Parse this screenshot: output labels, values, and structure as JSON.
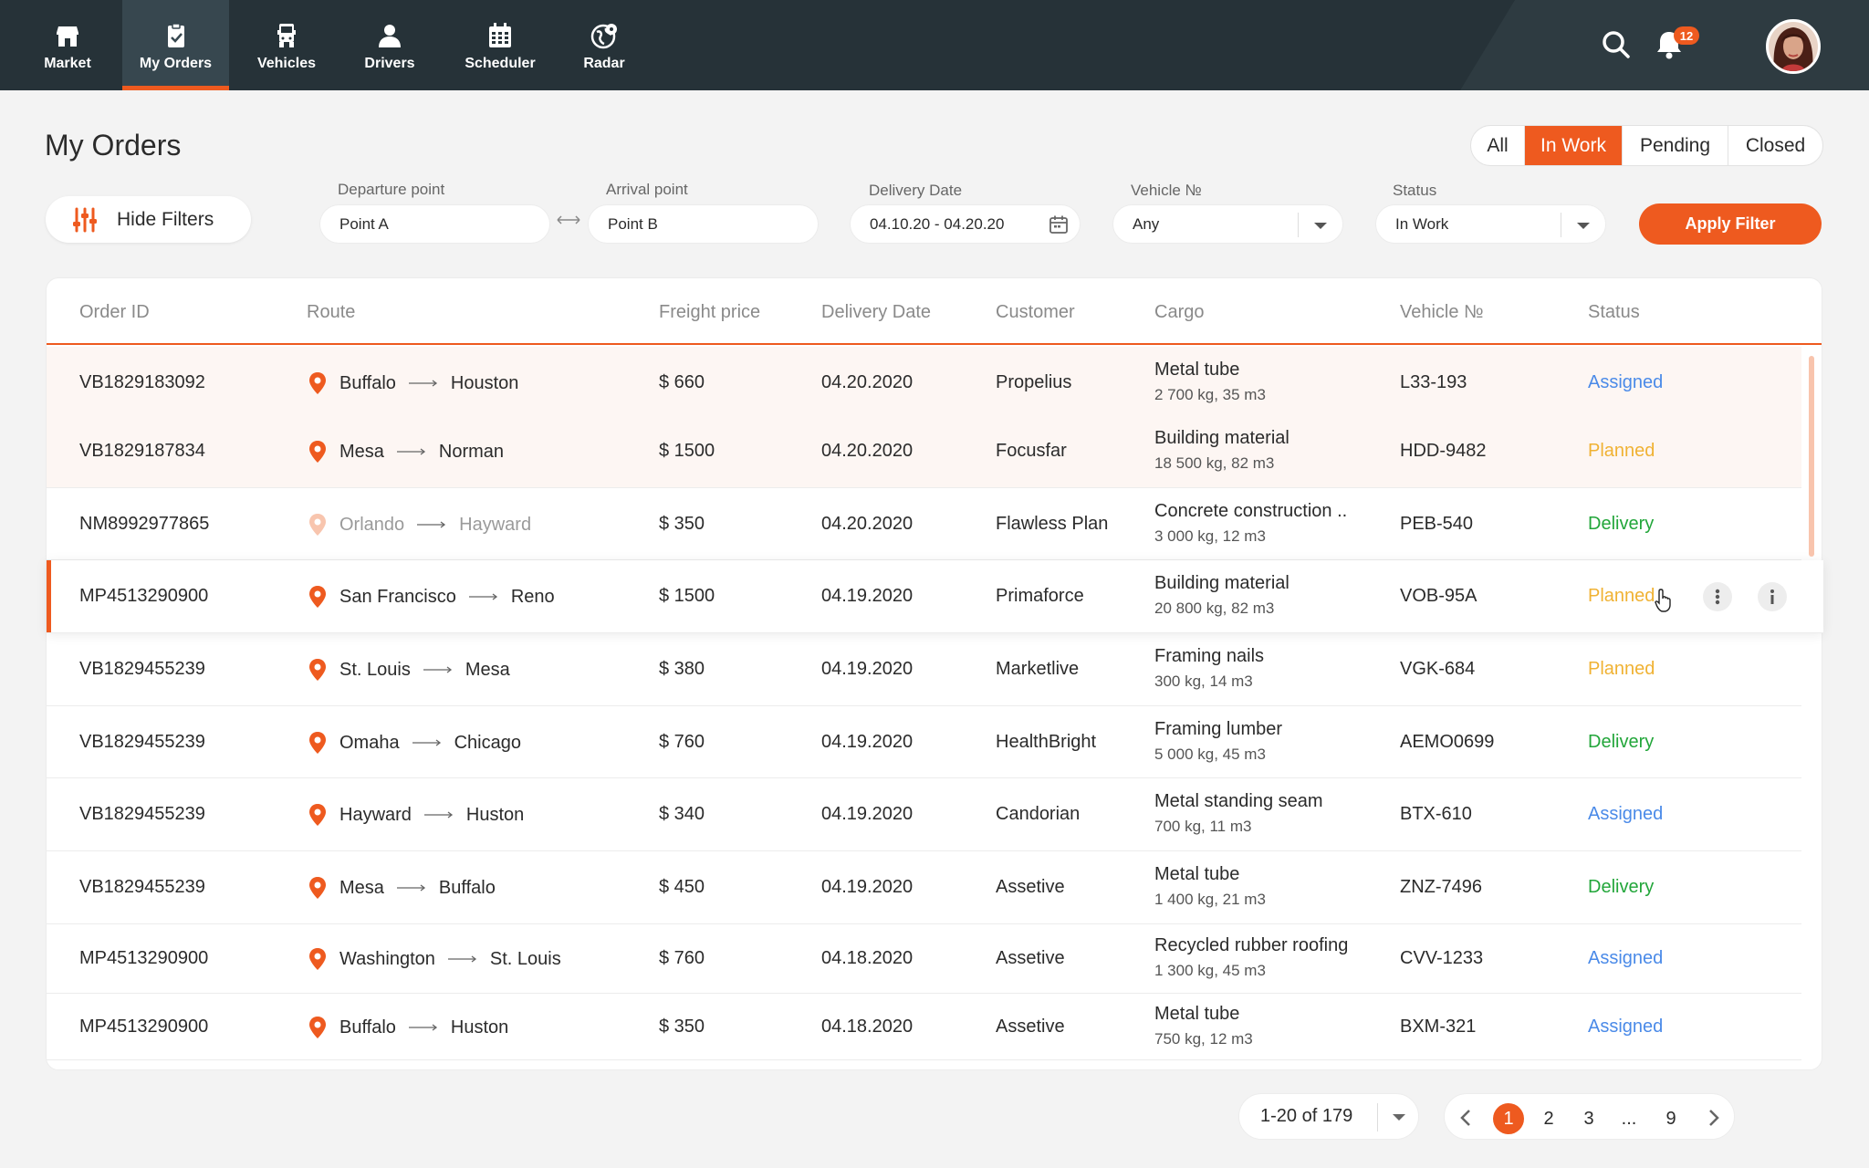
{
  "colors": {
    "accent": "#ee5a1f",
    "nav_bg": "#263238",
    "assigned": "#4a8ae8",
    "planned": "#f0b233",
    "delivery": "#22a63a"
  },
  "nav": {
    "items": [
      {
        "label": "Market",
        "icon": "market-icon"
      },
      {
        "label": "My Orders",
        "icon": "clipboard-icon",
        "active": true
      },
      {
        "label": "Vehicles",
        "icon": "truck-icon"
      },
      {
        "label": "Drivers",
        "icon": "driver-icon"
      },
      {
        "label": "Scheduler",
        "icon": "calendar-icon"
      },
      {
        "label": "Radar",
        "icon": "radar-icon"
      }
    ],
    "notification_count": "12"
  },
  "page": {
    "title": "My Orders"
  },
  "status_tabs": [
    "All",
    "In Work",
    "Pending",
    "Closed"
  ],
  "active_tab": "In Work",
  "filters": {
    "hide_label": "Hide Filters",
    "departure": {
      "label": "Departure point",
      "value": "Point A"
    },
    "arrival": {
      "label": "Arrival point",
      "value": "Point B"
    },
    "delivery_date": {
      "label": "Delivery Date",
      "value": "04.10.20 - 04.20.20"
    },
    "vehicle": {
      "label": "Vehicle №",
      "value": "Any"
    },
    "status": {
      "label": "Status",
      "value": "In Work"
    },
    "apply_label": "Apply Filter"
  },
  "table": {
    "headers": [
      "Order ID",
      "Route",
      "Freight price",
      "Delivery Date",
      "Customer",
      "Cargo",
      "Vehicle №",
      "Status"
    ],
    "rows": [
      {
        "id": "VB1829183092",
        "from": "Buffalo",
        "to": "Houston",
        "price": "$ 660",
        "date": "04.20.2020",
        "customer": "Propelius",
        "cargo": "Metal tube",
        "cargo_detail": "2 700 kg, 35 m3",
        "vehicle": "L33-193",
        "status": "Assigned"
      },
      {
        "id": "VB1829187834",
        "from": "Mesa",
        "to": "Norman",
        "price": "$ 1500",
        "date": "04.20.2020",
        "customer": "Focusfar",
        "cargo": "Building material",
        "cargo_detail": "18 500 kg, 82 m3",
        "vehicle": "HDD-9482",
        "status": "Planned"
      },
      {
        "id": "NM8992977865",
        "from": "Orlando",
        "to": "Hayward",
        "price": "$ 350",
        "date": "04.20.2020",
        "customer": "Flawless Plan",
        "cargo": "Concrete construction ..",
        "cargo_detail": "3 000 kg, 12 m3",
        "vehicle": "PEB-540",
        "status": "Delivery"
      },
      {
        "id": "MP4513290900",
        "from": "San Francisco",
        "to": "Reno",
        "price": "$ 1500",
        "date": "04.19.2020",
        "customer": "Primaforce",
        "cargo": "Building material",
        "cargo_detail": "20 800 kg, 82 m3",
        "vehicle": "VOB-95A",
        "status": "Planned"
      },
      {
        "id": "VB1829455239",
        "from": "St. Louis",
        "to": "Mesa",
        "price": "$ 380",
        "date": "04.19.2020",
        "customer": "Marketlive",
        "cargo": "Framing nails",
        "cargo_detail": "300 kg, 14 m3",
        "vehicle": "VGK-684",
        "status": "Planned"
      },
      {
        "id": "VB1829455239",
        "from": "Omaha",
        "to": "Chicago",
        "price": "$ 760",
        "date": "04.19.2020",
        "customer": "HealthBright",
        "cargo": "Framing lumber",
        "cargo_detail": "5 000 kg, 45 m3",
        "vehicle": "AEMO0699",
        "status": "Delivery"
      },
      {
        "id": "VB1829455239",
        "from": "Hayward",
        "to": "Huston",
        "price": "$ 340",
        "date": "04.19.2020",
        "customer": "Candorian",
        "cargo": "Metal standing seam",
        "cargo_detail": "700 kg, 11 m3",
        "vehicle": "BTX-610",
        "status": "Assigned"
      },
      {
        "id": "VB1829455239",
        "from": "Mesa",
        "to": "Buffalo",
        "price": "$ 450",
        "date": "04.19.2020",
        "customer": "Assetive",
        "cargo": "Metal tube",
        "cargo_detail": "1 400 kg, 21 m3",
        "vehicle": "ZNZ-7496",
        "status": "Delivery"
      },
      {
        "id": "MP4513290900",
        "from": "Washington",
        "to": "St. Louis",
        "price": "$ 760",
        "date": "04.18.2020",
        "customer": "Assetive",
        "cargo": "Recycled rubber roofing",
        "cargo_detail": "1 300 kg, 45 m3",
        "vehicle": "CVV-1233",
        "status": "Assigned"
      },
      {
        "id": "MP4513290900",
        "from": "Buffalo",
        "to": "Huston",
        "price": "$ 350",
        "date": "04.18.2020",
        "customer": "Assetive",
        "cargo": "Metal tube",
        "cargo_detail": "750 kg, 12 m3",
        "vehicle": "BXM-321",
        "status": "Assigned"
      }
    ]
  },
  "pagination": {
    "range": "1-20 of 179",
    "pages": [
      "1",
      "2",
      "3",
      "...",
      "9"
    ],
    "current": "1"
  }
}
